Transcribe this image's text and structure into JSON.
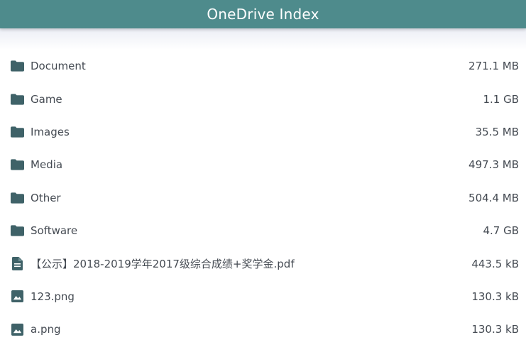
{
  "header": {
    "title": "OneDrive Index"
  },
  "colors": {
    "header_bg": "#4e8b8c",
    "icon": "#3f6268",
    "text": "#444a52"
  },
  "items": [
    {
      "name": "Document",
      "size": "271.1 MB",
      "icon": "folder-icon"
    },
    {
      "name": "Game",
      "size": "1.1 GB",
      "icon": "folder-icon"
    },
    {
      "name": "Images",
      "size": "35.5 MB",
      "icon": "folder-icon"
    },
    {
      "name": "Media",
      "size": "497.3 MB",
      "icon": "folder-icon"
    },
    {
      "name": "Other",
      "size": "504.4 MB",
      "icon": "folder-icon"
    },
    {
      "name": "Software",
      "size": "4.7 GB",
      "icon": "folder-icon"
    },
    {
      "name": "【公示】2018-2019学年2017级综合成绩+奖学金.pdf",
      "size": "443.5 kB",
      "icon": "document-icon"
    },
    {
      "name": "123.png",
      "size": "130.3 kB",
      "icon": "image-icon"
    },
    {
      "name": "a.png",
      "size": "130.3 kB",
      "icon": "image-icon"
    }
  ]
}
